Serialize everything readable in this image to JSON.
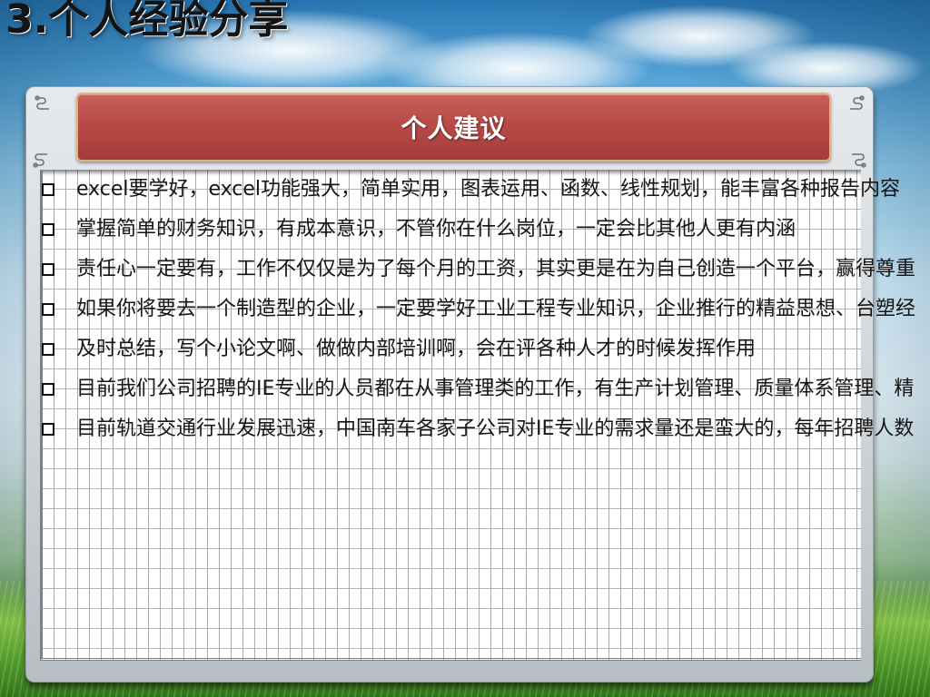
{
  "slide": {
    "title": "3.个人经验分享"
  },
  "panel": {
    "header": "个人建议",
    "items": [
      "excel要学好，excel功能强大，简单实用，图表运用、函数、线性规划，能丰富各种报告内容",
      "掌握简单的财务知识，有成本意识，不管你在什么岗位，一定会比其他人更有内涵",
      "责任心一定要有，工作不仅仅是为了每个月的工资，其实更是在为自己创造一个平台，赢得尊重",
      "如果你将要去一个制造型的企业，一定要学好工业工程专业知识，企业推行的精益思想、台塑经",
      "及时总结，写个小论文啊、做做内部培训啊，会在评各种人才的时候发挥作用",
      "目前我们公司招聘的IE专业的人员都在从事管理类的工作，有生产计划管理、质量体系管理、精",
      "目前轨道交通行业发展迅速，中国南车各家子公司对IE专业的需求量还是蛮大的，每年招聘人数"
    ]
  },
  "icons": {
    "bullet": "bullet-square-icon",
    "ornament": "corner-ornament-icon"
  },
  "colors": {
    "banner": "#b84b47",
    "banner_border": "#d9b487",
    "banner_text": "#ffffff",
    "title_text": "#141414",
    "frame": "#cdd2d6",
    "paper_lines": "#a9a9a9"
  }
}
